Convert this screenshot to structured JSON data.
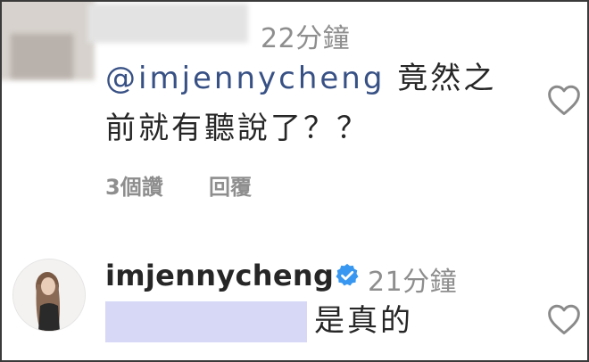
{
  "comment": {
    "time": "22分鐘",
    "mention": "@imjennycheng",
    "text_line1": "竟然之",
    "text_line2": "前就有聽說了？？",
    "likes": "3個讚",
    "reply": "回覆"
  },
  "reply": {
    "username": "imjennycheng",
    "time": "21分鐘",
    "text": "是真的"
  },
  "icons": {
    "heart": "heart-outline-icon",
    "verified": "verified-badge-icon"
  },
  "colors": {
    "mention": "#385185",
    "verified": "#3897f0",
    "mask": "#d6d8f6"
  }
}
